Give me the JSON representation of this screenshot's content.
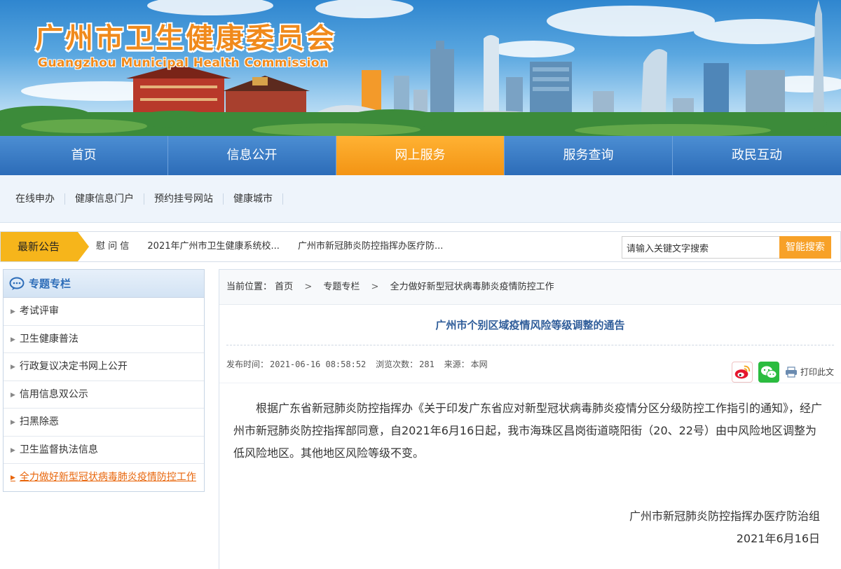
{
  "header": {
    "title": "广州市卫生健康委员会",
    "subtitle": "Guangzhou Municipal Health Commission"
  },
  "mainnav": {
    "items": [
      {
        "label": "首页"
      },
      {
        "label": "信息公开"
      },
      {
        "label": "网上服务"
      },
      {
        "label": "服务查询"
      },
      {
        "label": "政民互动"
      }
    ],
    "active_index": 2
  },
  "subnav": {
    "items": [
      {
        "label": "在线申办"
      },
      {
        "label": "健康信息门户"
      },
      {
        "label": "预约挂号网站"
      },
      {
        "label": "健康城市"
      }
    ]
  },
  "notice": {
    "label": "最新公告",
    "items": [
      "慰 问 信",
      "2021年广州市卫生健康系统校...",
      "广州市新冠肺炎防控指挥办医疗防..."
    ]
  },
  "search": {
    "value": "请输入关键文字搜索",
    "button_label": "智能搜索"
  },
  "sidebar": {
    "title": "专题专栏",
    "icon": "speech-bubble-icon",
    "items": [
      {
        "label": "考试评审"
      },
      {
        "label": "卫生健康普法"
      },
      {
        "label": "行政复议决定书网上公开"
      },
      {
        "label": "信用信息双公示"
      },
      {
        "label": "扫黑除恶"
      },
      {
        "label": "卫生监督执法信息"
      },
      {
        "label": "全力做好新型冠状病毒肺炎疫情防控工作"
      }
    ],
    "active_index": 6
  },
  "breadcrumb": {
    "prefix": "当前位置：",
    "items": [
      "首页",
      "专题专栏",
      "全力做好新型冠状病毒肺炎疫情防控工作"
    ],
    "separator": ">"
  },
  "article": {
    "title": "广州市个别区域疫情风险等级调整的通告",
    "publish_label": "发布时间：",
    "publish_time": "2021-06-16 08:58:52",
    "views_label": "浏览次数：",
    "views": "281",
    "source_label": "来源：",
    "source": "本网",
    "share": {
      "weibo_icon": "weibo-icon",
      "wechat_icon": "wechat-icon",
      "print_label": "打印此文"
    },
    "body": "根据广东省新冠肺炎防控指挥办《关于印发广东省应对新型冠状病毒肺炎疫情分区分级防控工作指引的通知》，经广州市新冠肺炎防控指挥部同意，自2021年6月16日起，我市海珠区昌岗街道晓阳街（20、22号）由中风险地区调整为低风险地区。其他地区风险等级不变。",
    "signature": "广州市新冠肺炎防控指挥办医疗防治组",
    "date": "2021年6月16日"
  },
  "colors": {
    "nav_blue": "#2c6cb8",
    "nav_active_orange": "#f39414",
    "title_orange": "#f08a1c",
    "notice_yellow": "#f6b51b",
    "link_active": "#e8650a"
  }
}
